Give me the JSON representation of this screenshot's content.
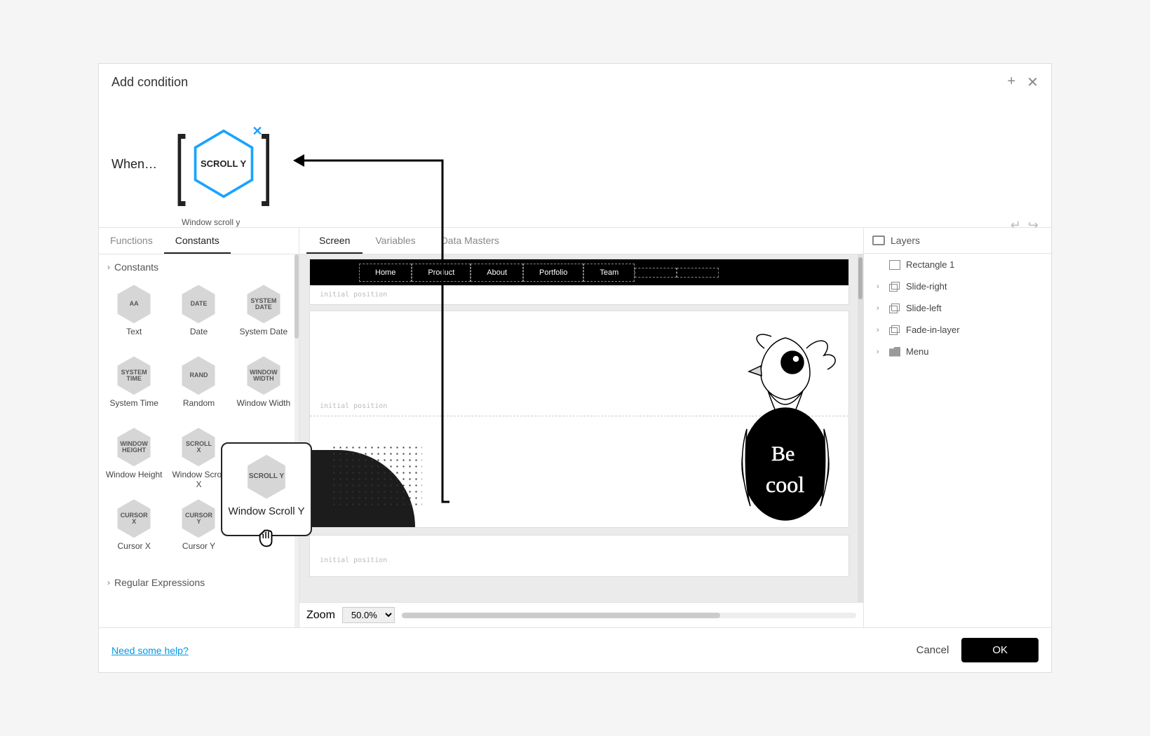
{
  "dialog": {
    "title": "Add condition"
  },
  "titlebar_icons": {
    "add": "+",
    "close": "✕"
  },
  "expr": {
    "when": "When…",
    "chip_text": "SCROLL Y",
    "chip_sub": "Window scroll y",
    "chip_close": "✕"
  },
  "left": {
    "tabs": [
      "Functions",
      "Constants"
    ],
    "active_tab": 1,
    "sections": {
      "constants": "Constants",
      "regex": "Regular Expressions"
    },
    "constants": [
      {
        "hx": "AA",
        "label": "Text"
      },
      {
        "hx": "DATE",
        "label": "Date"
      },
      {
        "hx": "SYSTEM DATE",
        "label": "System Date"
      },
      {
        "hx": "SYSTEM TIME",
        "label": "System Time"
      },
      {
        "hx": "RAND",
        "label": "Random"
      },
      {
        "hx": "WINDOW WIDTH",
        "label": "Window Width"
      },
      {
        "hx": "WINDOW HEIGHT",
        "label": "Window Height"
      },
      {
        "hx": "SCROLL X",
        "label": "Window Scroll X"
      },
      {
        "hx": "SCROLL Y",
        "label": "Window Scroll Y"
      },
      {
        "hx": "CURSOR X",
        "label": "Cursor X"
      },
      {
        "hx": "CURSOR Y",
        "label": "Cursor Y"
      }
    ]
  },
  "center": {
    "tabs": [
      "Screen",
      "Variables",
      "Data Masters"
    ],
    "active_tab": 0,
    "menu_items": [
      "Home",
      "Product",
      "About",
      "Portfolio",
      "Team"
    ],
    "placeholder": "initial position",
    "zoom_label": "Zoom",
    "zoom_value": "50.0%",
    "bird_text": "Be cool"
  },
  "right": {
    "header": "Layers",
    "layers": [
      {
        "name": "Rectangle 1",
        "icon": "rect",
        "expand": false
      },
      {
        "name": "Slide-right",
        "icon": "stack",
        "expand": true
      },
      {
        "name": "Slide-left",
        "icon": "stack",
        "expand": true
      },
      {
        "name": "Fade-in-layer",
        "icon": "stack",
        "expand": true
      },
      {
        "name": "Menu",
        "icon": "folder",
        "expand": true
      }
    ]
  },
  "footer": {
    "help": "Need some help?",
    "cancel": "Cancel",
    "ok": "OK"
  },
  "popover": {
    "hx": "SCROLL Y",
    "label": "Window Scroll Y"
  }
}
